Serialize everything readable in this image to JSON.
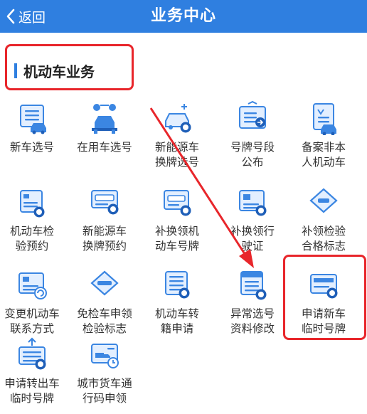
{
  "header": {
    "back_label": "返回",
    "title": "业务中心"
  },
  "section": {
    "title": "机动车业务"
  },
  "colors": {
    "primary": "#2f7fe0",
    "highlight": "#e8262b"
  },
  "items": [
    {
      "line1": "新车选号",
      "line2": "",
      "icon": "new-car-plate-icon"
    },
    {
      "line1": "在用车选号",
      "line2": "",
      "icon": "used-car-icon"
    },
    {
      "line1": "新能源车",
      "line2": "换牌选号",
      "icon": "ev-car-exchange-icon"
    },
    {
      "line1": "号牌号段",
      "line2": "公布",
      "icon": "plate-segment-board-icon"
    },
    {
      "line1": "备案非本",
      "line2": "人机动车",
      "icon": "filing-document-icon"
    },
    {
      "line1": "机动车检",
      "line2": "验预约",
      "icon": "inspection-booking-icon"
    },
    {
      "line1": "新能源车",
      "line2": "换牌预约",
      "icon": "ev-plate-booking-icon"
    },
    {
      "line1": "补换领机",
      "line2": "动车号牌",
      "icon": "plate-replace-icon"
    },
    {
      "line1": "补换领行",
      "line2": "驶证",
      "icon": "license-replace-icon"
    },
    {
      "line1": "补领检验",
      "line2": "合格标志",
      "icon": "inspection-mark-icon"
    },
    {
      "line1": "变更机动车",
      "line2": "联系方式",
      "icon": "change-contact-icon"
    },
    {
      "line1": "免检车申领",
      "line2": "检验标志",
      "icon": "exempt-mark-icon"
    },
    {
      "line1": "机动车转",
      "line2": "籍申请",
      "icon": "transfer-icon"
    },
    {
      "line1": "异常选号",
      "line2": "资料修改",
      "icon": "edit-info-icon"
    },
    {
      "line1": "申请新车",
      "line2": "临时号牌",
      "icon": "temp-plate-new-icon"
    },
    {
      "line1": "申请转出车",
      "line2": "临时号牌",
      "icon": "temp-plate-transfer-icon"
    },
    {
      "line1": "城市货车通",
      "line2": "行码申领",
      "icon": "truck-pass-icon"
    }
  ]
}
